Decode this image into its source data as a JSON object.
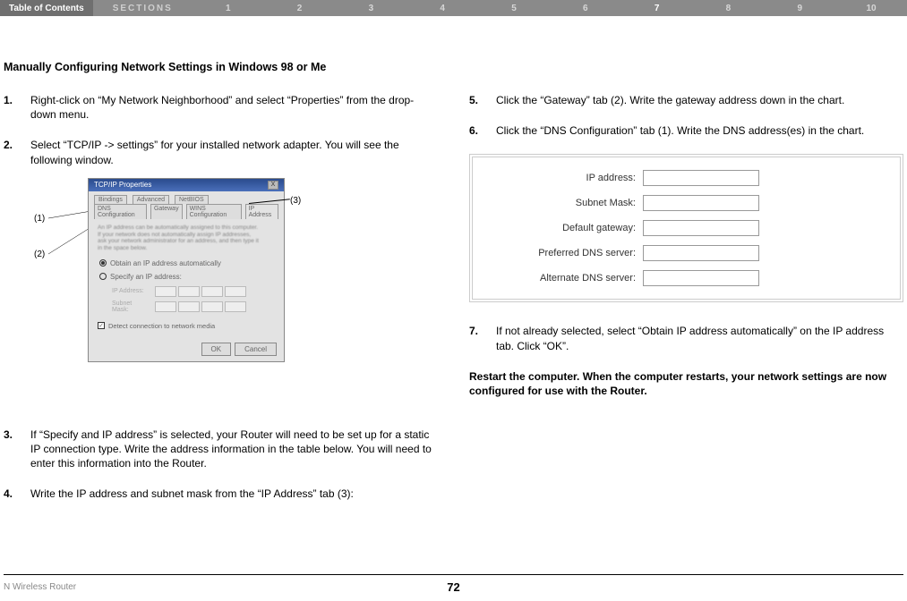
{
  "toc": "Table of Contents",
  "sections_label": "SECTIONS",
  "sections": [
    "1",
    "2",
    "3",
    "4",
    "5",
    "6",
    "7",
    "8",
    "9",
    "10"
  ],
  "active_section": "7",
  "heading": "Manually Configuring Network Settings in Windows 98 or Me",
  "left_steps": [
    {
      "num": "1.",
      "txt": "Right-click on “My Network Neighborhood” and select “Properties” from the drop-down menu."
    },
    {
      "num": "2.",
      "txt": "Select “TCP/IP -> settings” for your installed network adapter. You will see the following window."
    },
    {
      "num": "3.",
      "txt": "If “Specify and IP address” is selected, your Router will need to be set up for a static IP connection type. Write the address information in the table below. You will need to enter this information into the Router."
    },
    {
      "num": "4.",
      "txt": "Write the IP address and subnet mask from the “IP Address” tab (3):"
    }
  ],
  "right_steps": [
    {
      "num": "5.",
      "txt": "Click the “Gateway” tab (2). Write the gateway address down in the chart."
    },
    {
      "num": "6.",
      "txt": "Click the “DNS Configuration” tab (1). Write the DNS address(es) in the chart."
    },
    {
      "num": "7.",
      "txt": "If not already selected, select “Obtain IP address automatically” on the IP address tab. Click “OK”."
    }
  ],
  "restart_note": "Restart the computer. When the computer restarts, your network settings are now configured for use with the Router.",
  "callouts": {
    "c1": "(1)",
    "c2": "(2)",
    "c3": "(3)"
  },
  "shot": {
    "title": "TCP/IP Properties",
    "close": "X",
    "tabs_top": [
      "Bindings",
      "Advanced",
      "NetBIOS"
    ],
    "tabs_bot": [
      "DNS Configuration",
      "Gateway",
      "WINS Configuration",
      "IP Address"
    ],
    "blurb": "An IP address can be automatically assigned to this computer. If your network does not automatically assign IP addresses, ask your network administrator for an address, and then type it in the space below.",
    "radio_auto": "Obtain an IP address automatically",
    "radio_spec": "Specify an IP address:",
    "ip_lbl": "IP Address:",
    "mask_lbl": "Subnet Mask:",
    "chk": "Detect connection to network media",
    "ok": "OK",
    "cancel": "Cancel"
  },
  "form_labels": {
    "ip": "IP address:",
    "mask": "Subnet Mask:",
    "gw": "Default gateway:",
    "pdns": "Preferred DNS server:",
    "adns": "Alternate DNS server:"
  },
  "footer": {
    "model": "N Wireless Router",
    "page": "72"
  }
}
